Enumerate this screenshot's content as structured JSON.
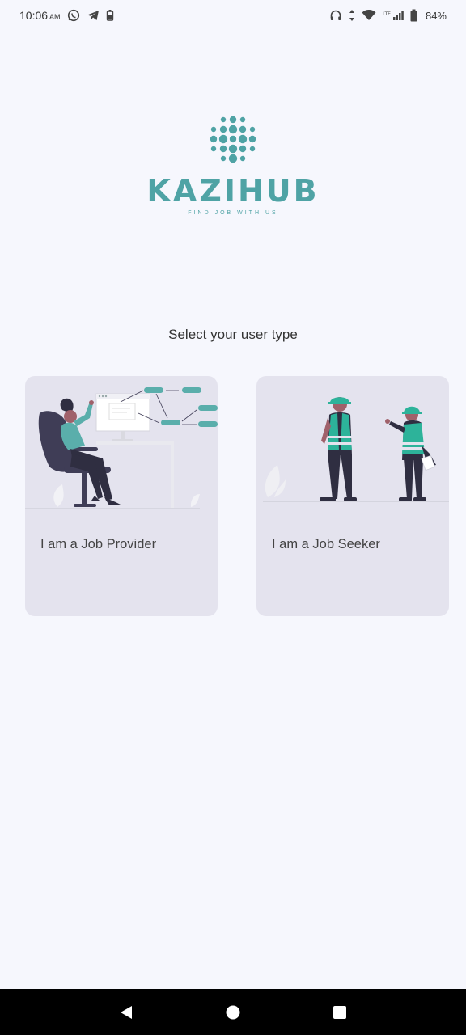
{
  "status_bar": {
    "time": "10:06",
    "ampm": "AM",
    "battery_percent": "84%",
    "icons": [
      "whatsapp-icon",
      "telegram-icon",
      "battery-saver-icon",
      "headset-icon",
      "data-arrows-icon",
      "wifi-icon",
      "lte-signal-icon",
      "battery-icon"
    ]
  },
  "logo": {
    "title": "KAZIHUB",
    "tagline": "FIND JOB WITH US",
    "color": "#4fa3a5"
  },
  "prompt": "Select your user type",
  "cards": [
    {
      "id": "provider",
      "label": "I am a Job Provider"
    },
    {
      "id": "seeker",
      "label": "I am a Job Seeker"
    }
  ],
  "nav": {
    "back": "back-icon",
    "home": "home-icon",
    "recents": "recents-icon"
  },
  "colors": {
    "accent": "#4fa3a5",
    "teal": "#5aaeab",
    "card_bg": "#e4e3ee",
    "page_bg": "#f6f7fd",
    "dark": "#2f2e41"
  }
}
